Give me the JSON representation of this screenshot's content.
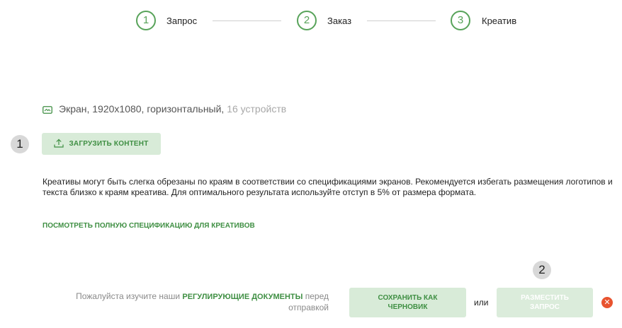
{
  "stepper": {
    "steps": [
      {
        "number": "1",
        "label": "Запрос"
      },
      {
        "number": "2",
        "label": "Заказ"
      },
      {
        "number": "3",
        "label": "Креатив"
      }
    ]
  },
  "screen": {
    "description": "Экран, 1920x1080, горизонтальный,",
    "devices": "16 устройств",
    "icon": "screen-icon"
  },
  "annotations": {
    "badge_1": "1",
    "badge_2": "2"
  },
  "upload": {
    "label": "ЗАГРУЗИТЬ КОНТЕНТ",
    "icon": "upload-icon"
  },
  "notice": {
    "text": "Креативы могут быть слегка обрезаны по краям в соответствии со спецификациями экранов. Рекомендуется избегать размещения логотипов и текста близко к краям креатива. Для оптимального результата используйте отступ в 5% от размера формата."
  },
  "spec_link": "ПОСМОТРЕТЬ ПОЛНУЮ СПЕЦИФИКАЦИЮ ДЛЯ КРЕАТИВОВ",
  "footer": {
    "docs_prefix": "Пожалуйста изучите наши",
    "docs_link": "РЕГУЛИРУЮЩИЕ ДОКУМЕНТЫ",
    "docs_suffix": "перед отправкой",
    "draft_line1": "СОХРАНИТЬ КАК",
    "draft_line2": "ЧЕРНОВИК",
    "or": "или",
    "publish_line1": "РАЗМЕСТИТЬ",
    "publish_line2": "ЗАПРОС",
    "close_icon": "close-icon"
  },
  "colors": {
    "accent": "#58a35a",
    "button_bg": "#d8ebd8",
    "danger": "#e8532f"
  }
}
